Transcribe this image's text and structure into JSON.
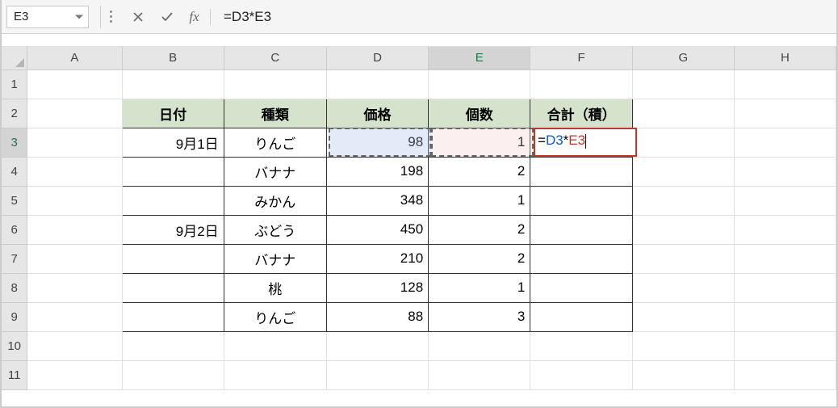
{
  "name_box": "E3",
  "formula_bar": "=D3*E3",
  "fx_label": "fx",
  "columns": [
    "A",
    "B",
    "C",
    "D",
    "E",
    "F",
    "G",
    "H"
  ],
  "rows": [
    "1",
    "2",
    "3",
    "4",
    "5",
    "6",
    "7",
    "8",
    "9",
    "10",
    "11"
  ],
  "headers": {
    "b": "日付",
    "c": "種類",
    "d": "価格",
    "e": "個数",
    "f": "合計（積）"
  },
  "data": [
    {
      "b": "9月1日",
      "c": "りんご",
      "d": "98",
      "e": "1"
    },
    {
      "b": "",
      "c": "バナナ",
      "d": "198",
      "e": "2"
    },
    {
      "b": "",
      "c": "みかん",
      "d": "348",
      "e": "1"
    },
    {
      "b": "9月2日",
      "c": "ぶどう",
      "d": "450",
      "e": "2"
    },
    {
      "b": "",
      "c": "バナナ",
      "d": "210",
      "e": "2"
    },
    {
      "b": "",
      "c": "桃",
      "d": "128",
      "e": "1"
    },
    {
      "b": "",
      "c": "りんご",
      "d": "88",
      "e": "3"
    }
  ],
  "editing_cell": {
    "eq": "=",
    "ref1": "D3",
    "op": "*",
    "ref2": "E3"
  }
}
